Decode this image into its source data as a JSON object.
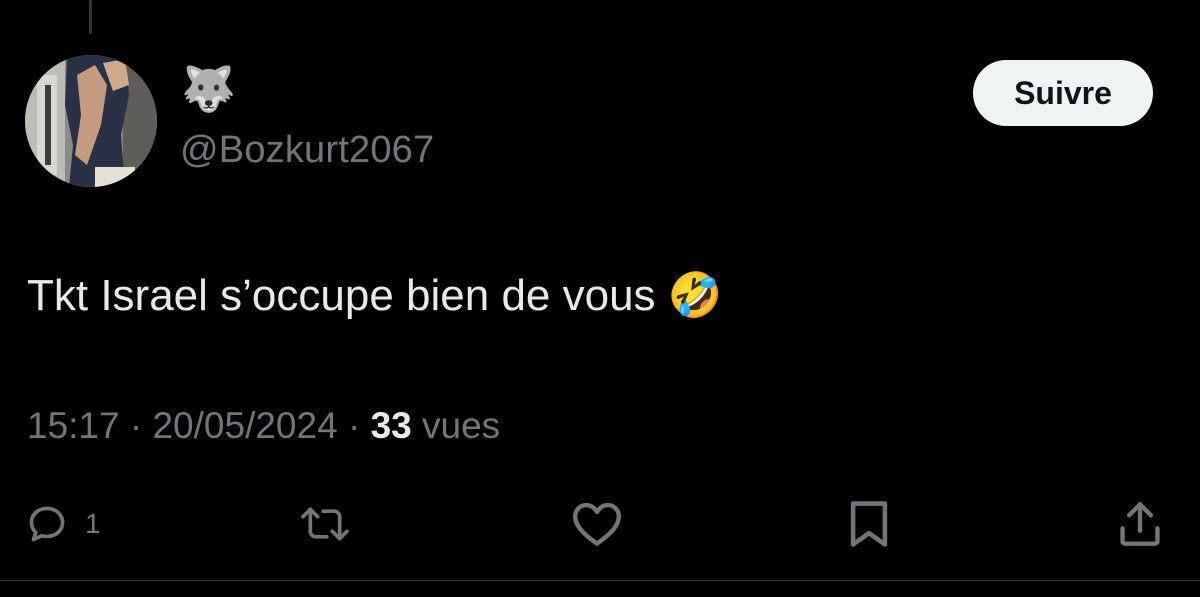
{
  "user": {
    "display_name": "🐺",
    "handle": "@Bozkurt2067"
  },
  "follow_label": "Suivre",
  "tweet": {
    "text": "Tkt Israel s’occupe bien de vous",
    "emoji": "🤣"
  },
  "meta": {
    "time": "15:17",
    "separator": "·",
    "date": "20/05/2024",
    "views_count": "33",
    "views_label": "vues"
  },
  "actions": {
    "reply_count": "1"
  },
  "colors": {
    "background": "#000000",
    "text": "#e7e9ea",
    "muted": "#71767b",
    "follow_bg": "#eff3f4",
    "follow_text": "#0f1419",
    "divider": "#2f3336"
  },
  "icons": [
    "reply-icon",
    "retweet-icon",
    "like-icon",
    "bookmark-icon",
    "share-icon"
  ]
}
